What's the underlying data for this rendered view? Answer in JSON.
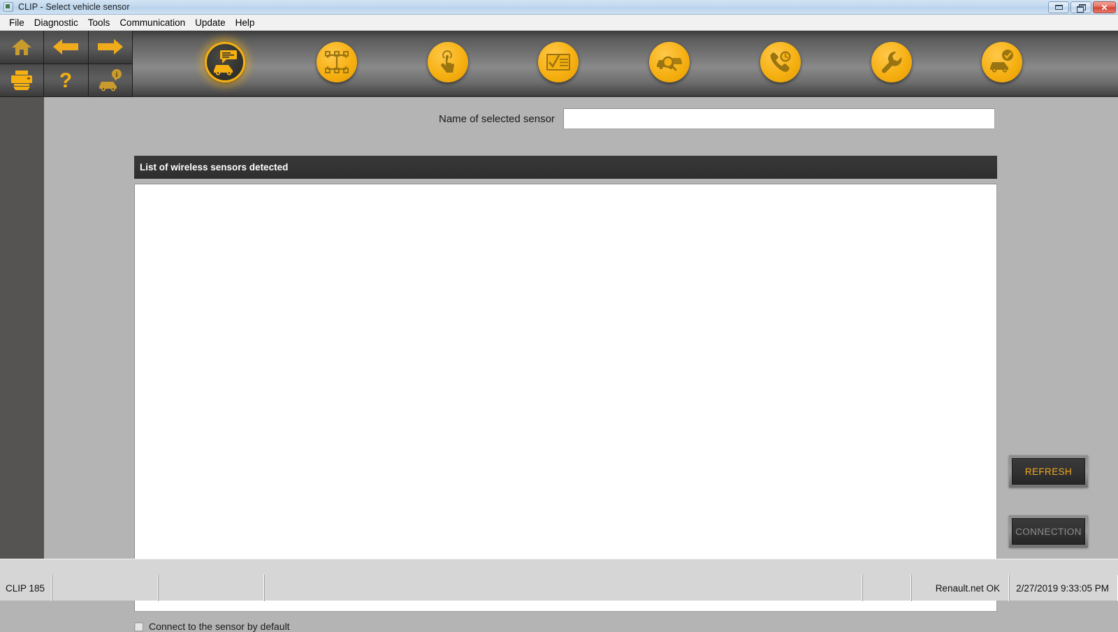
{
  "window": {
    "title": "CLIP - Select vehicle sensor",
    "app_icon": "app-icon",
    "minimize_label": "Minimize",
    "restore_label": "Restore",
    "close_label": "✕"
  },
  "menu": {
    "items": [
      {
        "label": "File",
        "name": "menu-file"
      },
      {
        "label": "Diagnostic",
        "name": "menu-diagnostic"
      },
      {
        "label": "Tools",
        "name": "menu-tools"
      },
      {
        "label": "Communication",
        "name": "menu-communication"
      },
      {
        "label": "Update",
        "name": "menu-update"
      },
      {
        "label": "Help",
        "name": "menu-help"
      }
    ]
  },
  "nav_buttons": [
    {
      "icon": "home-icon",
      "label": "Home"
    },
    {
      "icon": "arrow-left-icon",
      "label": "Back"
    },
    {
      "icon": "arrow-right-icon",
      "label": "Forward"
    },
    {
      "icon": "print-icon",
      "label": "Print"
    },
    {
      "icon": "help-question-icon",
      "label": "Help"
    },
    {
      "icon": "vehicle-info-icon",
      "label": "Vehicle information"
    }
  ],
  "toolbar": {
    "icons": [
      {
        "icon": "vehicle-identification-icon",
        "label": "Vehicle identification",
        "selected": true
      },
      {
        "icon": "ecu-network-icon",
        "label": "Control unit network",
        "selected": false
      },
      {
        "icon": "touch-select-icon",
        "label": "Select function",
        "selected": false
      },
      {
        "icon": "checklist-icon",
        "label": "Test report",
        "selected": false
      },
      {
        "icon": "vehicle-search-icon",
        "label": "Vehicle search",
        "selected": false
      },
      {
        "icon": "phone-support-icon",
        "label": "Technical support",
        "selected": false
      },
      {
        "icon": "wrench-icon",
        "label": "Repair tools",
        "selected": false
      },
      {
        "icon": "vehicle-check-icon",
        "label": "Vehicle check",
        "selected": false
      }
    ]
  },
  "main": {
    "sensor_label": "Name of selected sensor",
    "sensor_value": "",
    "sensor_placeholder": "",
    "list_header": "List of wireless sensors detected",
    "list_items": [],
    "checkbox_label": "Connect to the sensor by default",
    "checkbox_checked": false,
    "refresh_button": "REFRESH",
    "connection_button": "CONNECTION"
  },
  "statusbar": {
    "cells": [
      {
        "text": "CLIP 185",
        "name": "status-clip-version"
      },
      {
        "text": "",
        "name": "status-cell-2"
      },
      {
        "text": "",
        "name": "status-cell-3"
      },
      {
        "text": "",
        "name": "status-cell-4"
      },
      {
        "text": "",
        "name": "status-cell-5"
      },
      {
        "text": "Renault.net OK",
        "name": "status-network"
      },
      {
        "text": "2/27/2019 9:33:05 PM",
        "name": "status-datetime"
      }
    ]
  },
  "colors": {
    "accent_yellow": "#f6b012",
    "toolbar_dark": "#5b5b5b",
    "panel_grey": "#b4b4b4",
    "header_dark": "#333333",
    "disabled_text": "#8d8d8d"
  }
}
